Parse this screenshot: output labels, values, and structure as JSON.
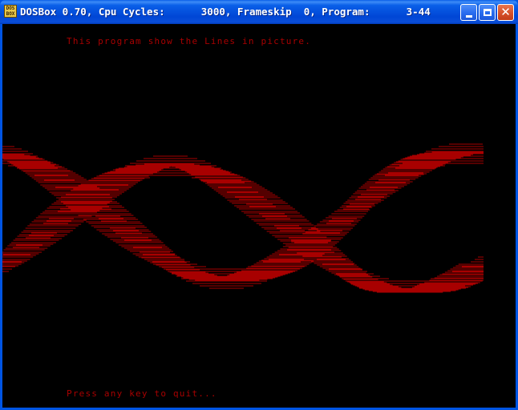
{
  "window": {
    "title": "DOSBox 0.70, Cpu Cycles:      3000, Frameskip  0, Program:      3-44",
    "icon_text": "DOS BOX"
  },
  "screen": {
    "header_text": "This program show the Lines in picture.",
    "footer_text": "Press any key to quit...",
    "text_color": "#a80000",
    "line_color": "#a80000",
    "background": "#000000"
  },
  "icons": {
    "minimize": "minimize-icon",
    "maximize": "maximize-icon",
    "close": "close-icon"
  }
}
